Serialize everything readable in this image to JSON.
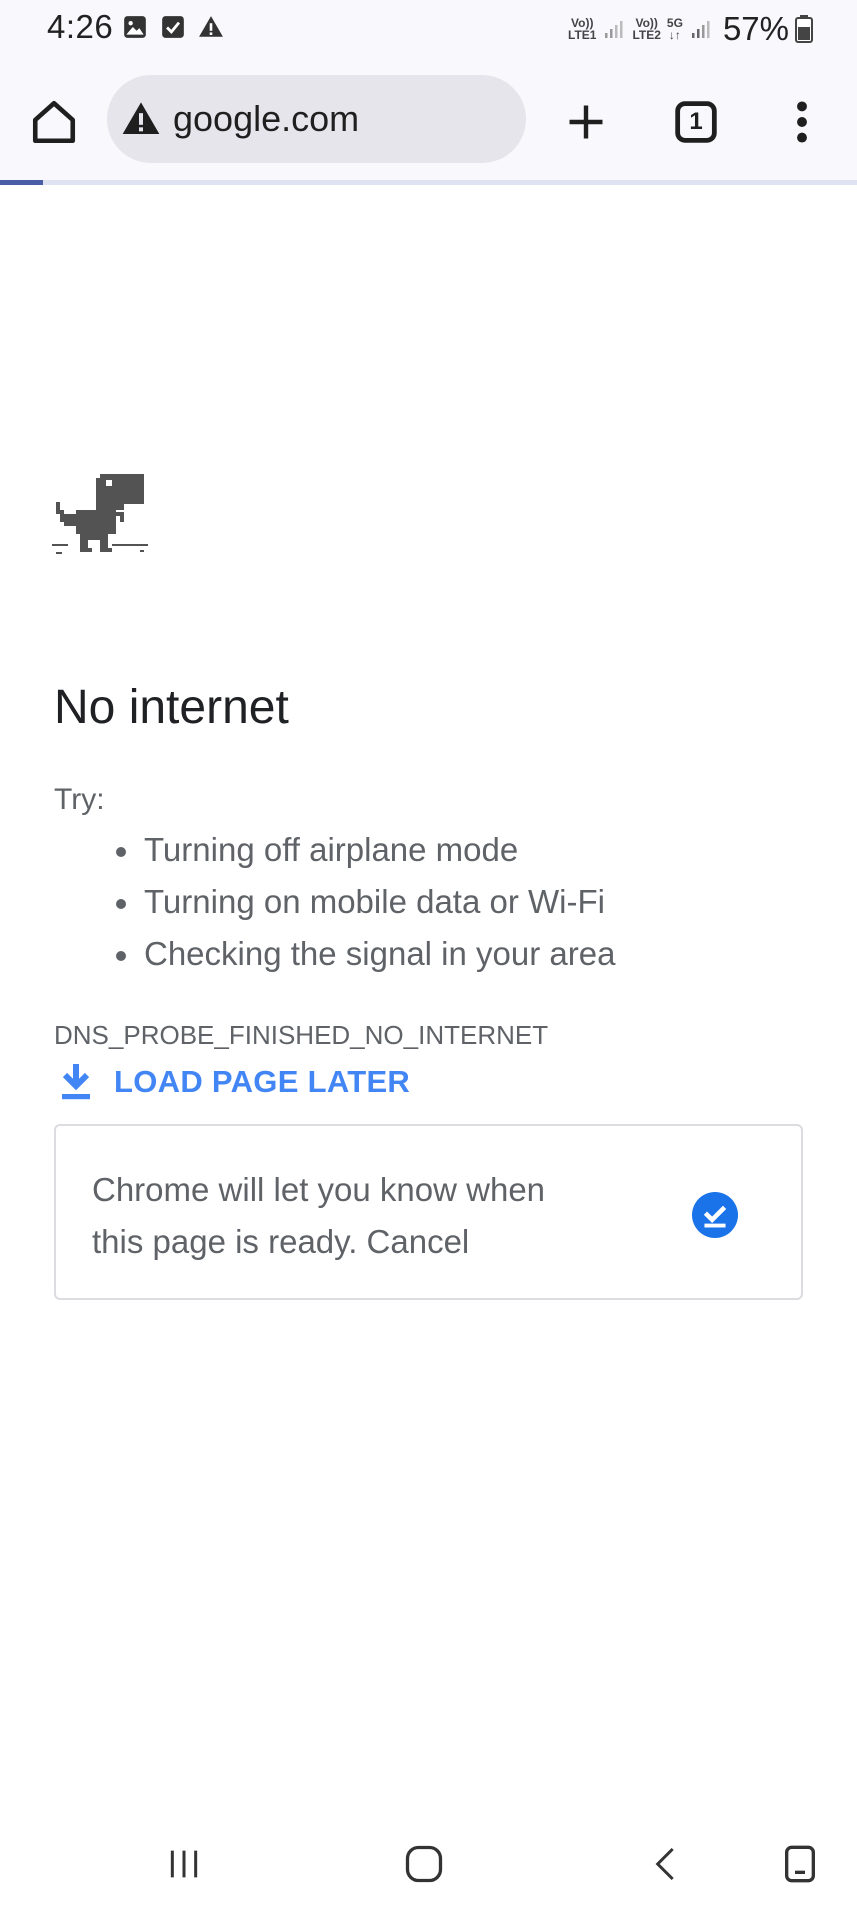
{
  "status_bar": {
    "time": "4:26",
    "left_icons": [
      "image-icon",
      "checkbox-icon",
      "warning-icon"
    ],
    "sim1_label_top": "Vo))",
    "sim1_label_bottom": "LTE1",
    "sim2_label_top": "Vo))",
    "sim2_label_bottom": "LTE2",
    "network_type": "5G",
    "battery_percent": "57%"
  },
  "toolbar": {
    "url": "google.com",
    "tab_count": "1",
    "page_load_progress": 0.05,
    "icons": {
      "home": "home-icon",
      "security": "warning-icon",
      "new_tab": "plus-icon",
      "tabs": "tab-switcher-icon",
      "menu": "more-vert-icon"
    }
  },
  "error_page": {
    "headline": "No internet",
    "try_label": "Try:",
    "suggestions": [
      "Turning off airplane mode",
      "Turning on mobile data or Wi-Fi",
      "Checking the signal in your area"
    ],
    "error_code": "DNS_PROBE_FINISHED_NO_INTERNET",
    "load_later_label": "LOAD PAGE LATER",
    "notice_line1": "Chrome will let you know when",
    "notice_line2": "this page is ready. Cancel"
  },
  "colors": {
    "link_blue": "#4285f4",
    "check_blue": "#1a73e8",
    "text_gray": "#5f6368",
    "progress": "#4a5ea8",
    "dino_gray": "#535353"
  },
  "nav_bar": {
    "icons": [
      "recent-apps-icon",
      "home-circle-icon",
      "back-icon",
      "screen-rotate-icon"
    ]
  }
}
